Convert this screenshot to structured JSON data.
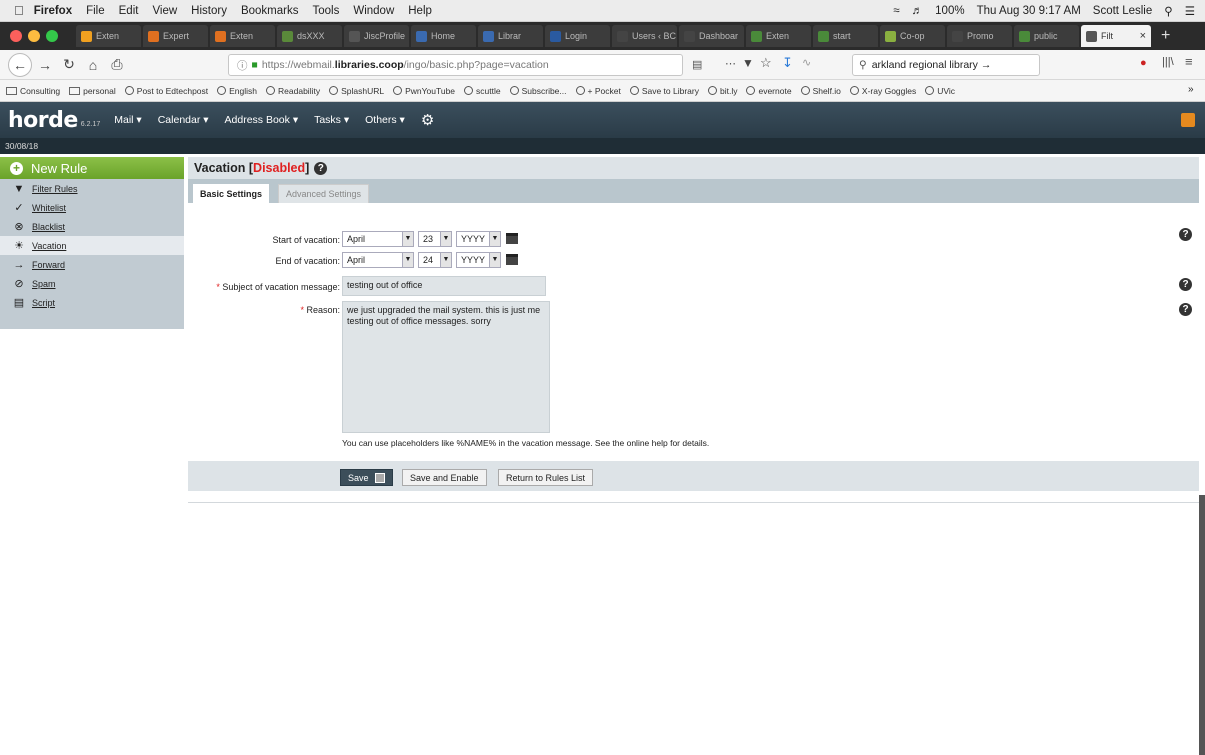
{
  "macbar": {
    "app": "Firefox",
    "menus": [
      "File",
      "Edit",
      "View",
      "History",
      "Bookmarks",
      "Tools",
      "Window",
      "Help"
    ],
    "battery": "100%",
    "datetime": "Thu Aug 30  9:17 AM",
    "user": "Scott Leslie"
  },
  "tabs": [
    {
      "label": "Exten",
      "color": "#f0a020"
    },
    {
      "label": "Expert",
      "color": "#e07020"
    },
    {
      "label": "Exten",
      "color": "#e07020"
    },
    {
      "label": "dsXXX",
      "color": "#5a8a3a"
    },
    {
      "label": "JiscProfile",
      "color": "#555"
    },
    {
      "label": "Home",
      "color": "#3a6ab0"
    },
    {
      "label": "Librar",
      "color": "#3a6ab0"
    },
    {
      "label": "Login",
      "color": "#2a5aa0"
    },
    {
      "label": "Users ‹ BC",
      "color": "#444"
    },
    {
      "label": "Dashboar",
      "color": "#444"
    },
    {
      "label": "Exten",
      "color": "#4a8a3a"
    },
    {
      "label": "start",
      "color": "#4a8a3a"
    },
    {
      "label": "Co-op",
      "color": "#8ab040"
    },
    {
      "label": "Promo",
      "color": "#444"
    },
    {
      "label": "public",
      "color": "#4a8a3a"
    },
    {
      "label": "Filt",
      "color": "#555",
      "active": true
    }
  ],
  "url": {
    "prefix": "https://webmail.",
    "domain": "libraries.coop",
    "suffix": "/ingo/basic.php?page=vacation"
  },
  "search": {
    "value": "arkland regional library →"
  },
  "bookmarks": [
    "Consulting",
    "personal",
    "Post to Edtechpost",
    "English",
    "Readability",
    "SplashURL",
    "PwnYouTube",
    "scuttle",
    "Subscribe...",
    "+ Pocket",
    "Save to Library",
    "bit.ly",
    "evernote",
    "Shelf.io",
    "X-ray Goggles",
    "UVic"
  ],
  "horde": {
    "logo": "horde",
    "version": "6.2.17",
    "menus": [
      "Mail ▾",
      "Calendar ▾",
      "Address Book ▾",
      "Tasks ▾",
      "Others ▾"
    ],
    "date": "30/08/18"
  },
  "sidebar": {
    "new_rule": "New Rule",
    "items": [
      {
        "label": "Filter Rules",
        "icon": "funnel-icon",
        "glyph": "▼"
      },
      {
        "label": "Whitelist",
        "icon": "check-circle-icon",
        "glyph": "✓"
      },
      {
        "label": "Blacklist",
        "icon": "x-circle-icon",
        "glyph": "⊗"
      },
      {
        "label": "Vacation",
        "icon": "vacation-icon",
        "glyph": "☀",
        "active": true
      },
      {
        "label": "Forward",
        "icon": "arrow-right-icon",
        "glyph": "→"
      },
      {
        "label": "Spam",
        "icon": "no-icon",
        "glyph": "⊘"
      },
      {
        "label": "Script",
        "icon": "document-icon",
        "glyph": "▤"
      }
    ]
  },
  "page": {
    "title": "Vacation [",
    "status": "Disabled",
    "title_end": "]"
  },
  "tabs_page": {
    "basic": "Basic Settings",
    "advanced": "Advanced Settings"
  },
  "form": {
    "start_label": "Start of vacation:",
    "start_month": "April",
    "start_day": "23",
    "start_year": "YYYY",
    "end_label": "End of vacation:",
    "end_month": "April",
    "end_day": "24",
    "end_year": "YYYY",
    "subject_label": "Subject of vacation message:",
    "subject_value": "testing out of office",
    "reason_label": "Reason:",
    "reason_value": "we just upgraded the mail system. this is just me testing out of office messages. sorry",
    "hint": "You can use placeholders like %NAME% in the vacation message. See the online help for details."
  },
  "buttons": {
    "save": "Save",
    "save_enable": "Save and Enable",
    "return": "Return to Rules List"
  }
}
